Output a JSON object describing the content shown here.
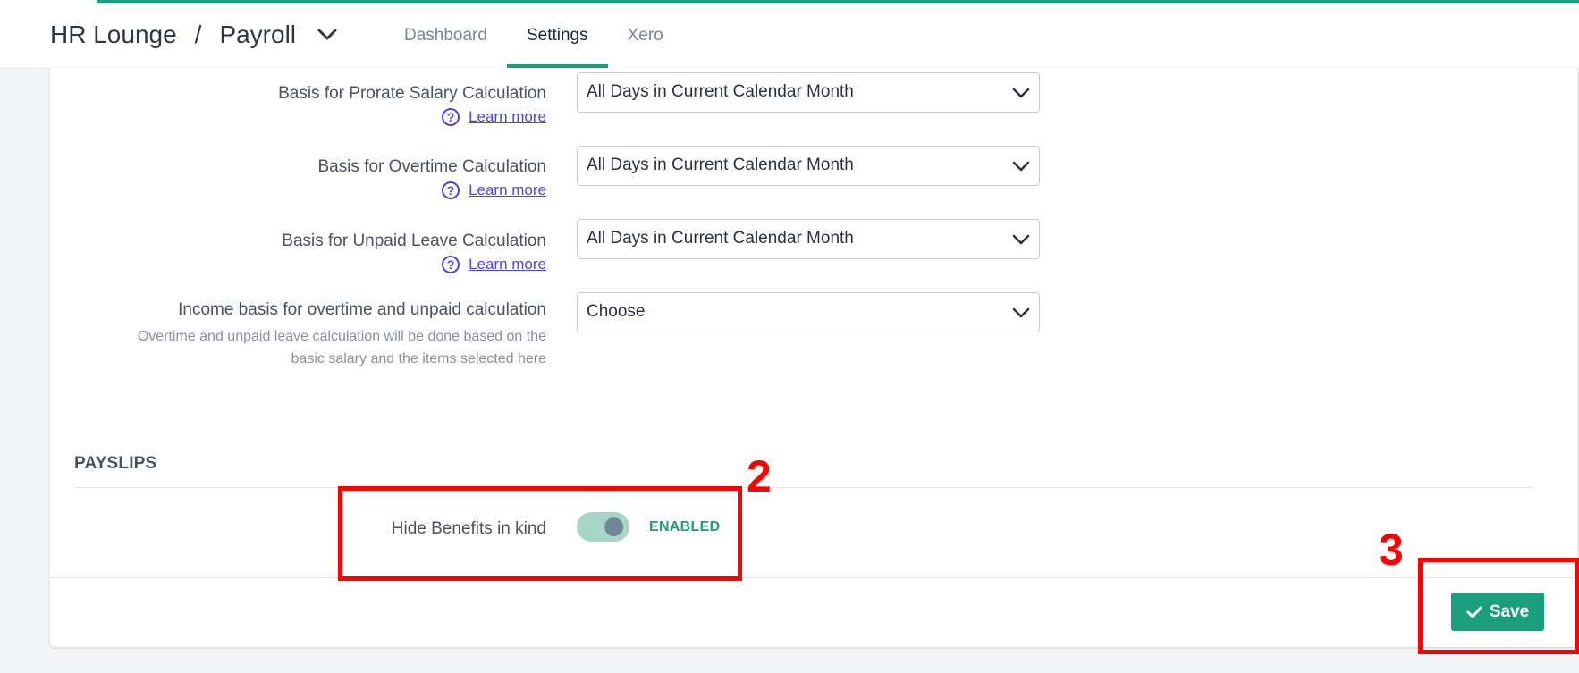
{
  "header": {
    "org": "HR Lounge",
    "separator": "/",
    "module": "Payroll",
    "tabs": [
      {
        "label": "Dashboard",
        "active": false
      },
      {
        "label": "Settings",
        "active": true
      },
      {
        "label": "Xero",
        "active": false
      }
    ]
  },
  "settings": {
    "rows": [
      {
        "label": "Basis for Prorate Salary Calculation",
        "help_link": "Learn more",
        "value": "All Days in Current Calendar Month"
      },
      {
        "label": "Basis for Overtime Calculation",
        "help_link": "Learn more",
        "value": "All Days in Current Calendar Month"
      },
      {
        "label": "Basis for Unpaid Leave Calculation",
        "help_link": "Learn more",
        "value": "All Days in Current Calendar Month"
      },
      {
        "label": "Income basis for overtime and unpaid calculation",
        "hint_line1": "Overtime and unpaid leave calculation will be done based on the",
        "hint_line2": "basic salary and the items selected here",
        "value": "Choose"
      }
    ]
  },
  "payslips": {
    "title": "PAYSLIPS",
    "hide_benefits_label": "Hide Benefits in kind",
    "hide_benefits_state": "ENABLED",
    "hide_benefits_on": true
  },
  "footer": {
    "save_label": "Save"
  },
  "annotations": {
    "step2": "2",
    "step3": "3"
  },
  "colors": {
    "accent": "#1a9e7d",
    "link": "#4f46d8",
    "annotation": "#ff0000"
  }
}
